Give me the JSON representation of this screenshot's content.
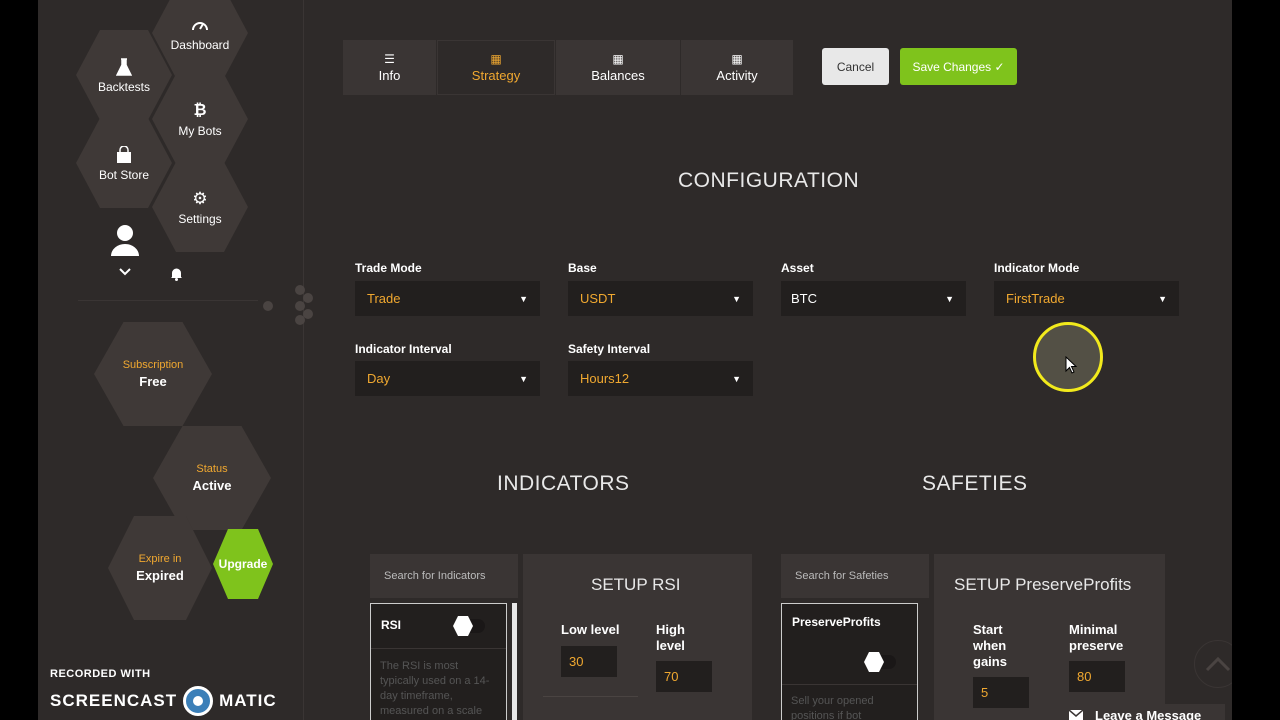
{
  "sidebar": {
    "dashboard": "Dashboard",
    "backtests": "Backtests",
    "my_bots": "My Bots",
    "bot_store": "Bot Store",
    "settings": "Settings",
    "subscription_label": "Subscription",
    "subscription_value": "Free",
    "status_label": "Status",
    "status_value": "Active",
    "expire_label": "Expire in",
    "expire_value": "Expired",
    "upgrade": "Upgrade"
  },
  "tabs": [
    {
      "label": "Info",
      "icon": "sliders-icon"
    },
    {
      "label": "Strategy",
      "icon": "calendar-icon"
    },
    {
      "label": "Balances",
      "icon": "calendar-icon"
    },
    {
      "label": "Activity",
      "icon": "calendar-icon"
    }
  ],
  "actions": {
    "cancel": "Cancel",
    "save": "Save Changes ✓"
  },
  "configuration": {
    "title": "CONFIGURATION",
    "trade_mode": {
      "label": "Trade Mode",
      "value": "Trade"
    },
    "base": {
      "label": "Base",
      "value": "USDT"
    },
    "asset": {
      "label": "Asset",
      "value": "BTC"
    },
    "indicator_mode": {
      "label": "Indicator Mode",
      "value": "FirstTrade"
    },
    "indicator_interval": {
      "label": "Indicator Interval",
      "value": "Day"
    },
    "safety_interval": {
      "label": "Safety Interval",
      "value": "Hours12"
    }
  },
  "indicators": {
    "title": "INDICATORS",
    "search_placeholder": "Search for Indicators",
    "card_title": "RSI",
    "card_desc": "The RSI is most typically used on a 14-day timeframe, measured on a scale",
    "setup_title": "SETUP RSI",
    "low_label": "Low level",
    "low_value": "30",
    "high_label": "High level",
    "high_value": "70"
  },
  "safeties": {
    "title": "SAFETIES",
    "search_placeholder": "Search for Safeties",
    "card_title": "PreserveProfits",
    "card_desc": "Sell your opened positions if bot",
    "setup_title": "SETUP PreserveProfits",
    "start_label": "Start when gains",
    "start_value": "5",
    "minimal_label": "Minimal preserve",
    "minimal_value": "80"
  },
  "watermark": {
    "recorded": "RECORDED WITH",
    "brand_left": "SCREENCAST",
    "brand_right": "MATIC"
  },
  "chat": {
    "label": "Leave a Message"
  },
  "colors": {
    "accent": "#f0a830",
    "green": "#7fc31c",
    "background": "#2e2a29",
    "panel": "#3a3534"
  }
}
